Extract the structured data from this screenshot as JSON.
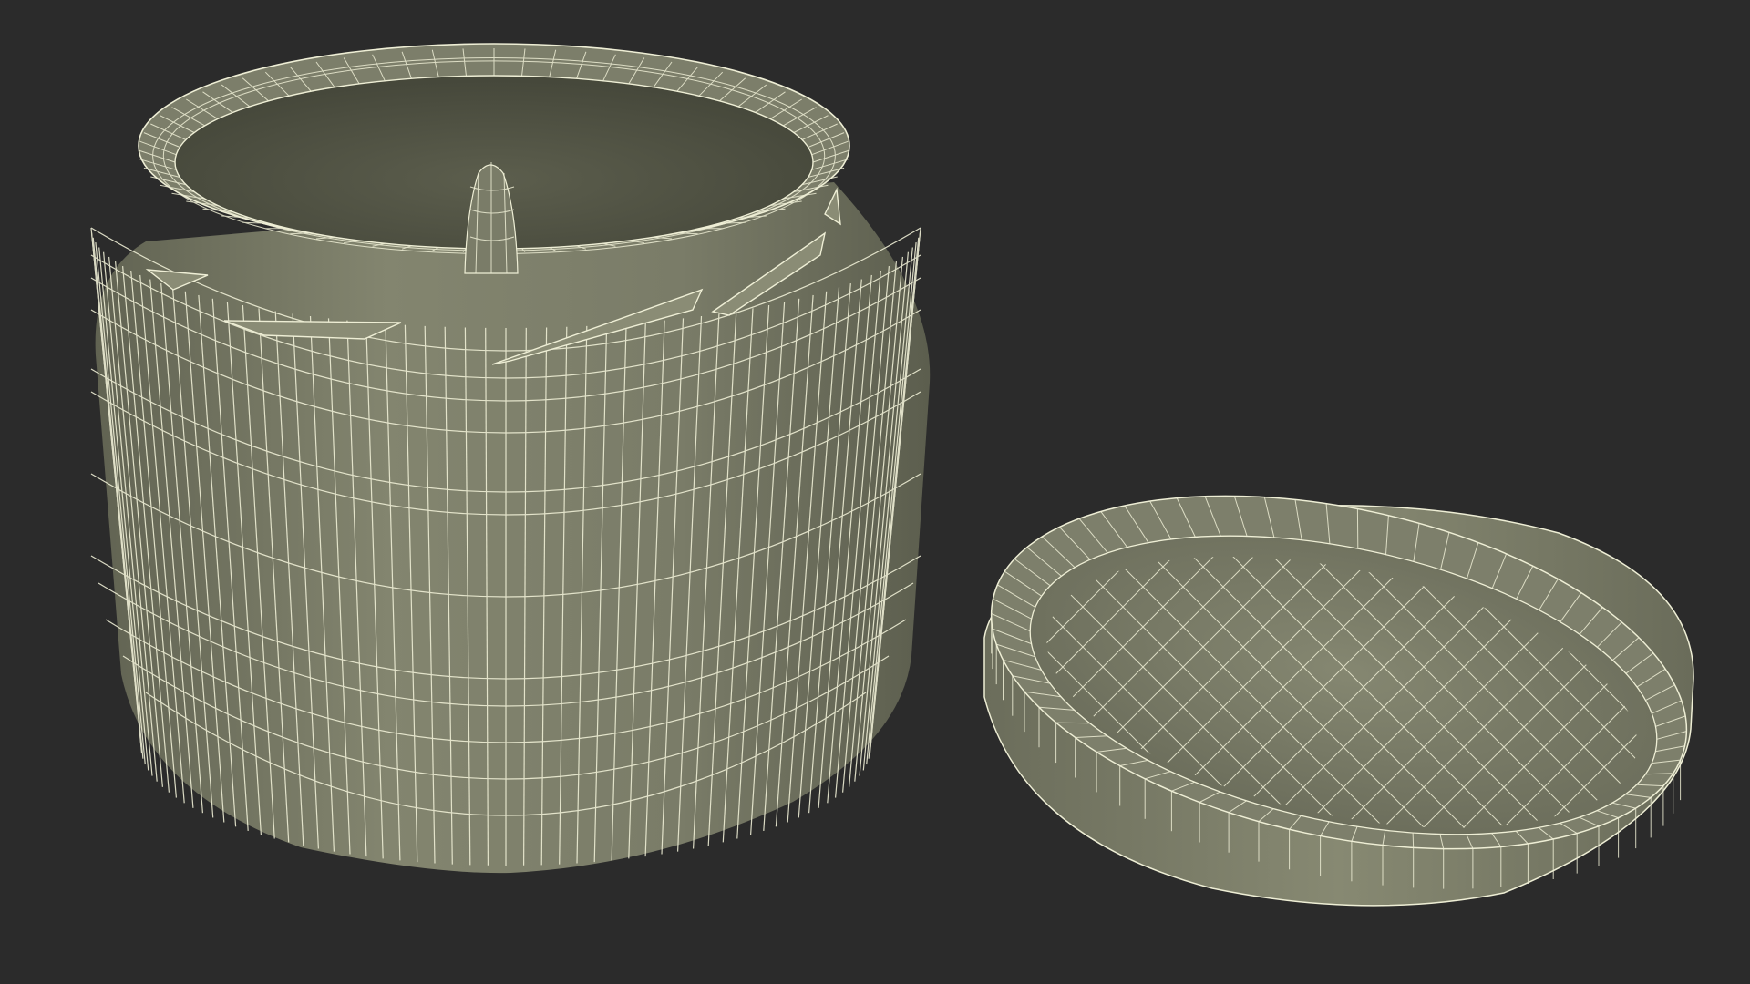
{
  "scene": {
    "objects": [
      "jar",
      "lid"
    ],
    "render_style": "wireframe-over-shaded",
    "colors": {
      "background": "#2b2b2b",
      "surface": "#7b7d6a",
      "surface_dark": "#5f6151",
      "surface_light": "#8e9079",
      "wire": "#eeeed5"
    }
  }
}
